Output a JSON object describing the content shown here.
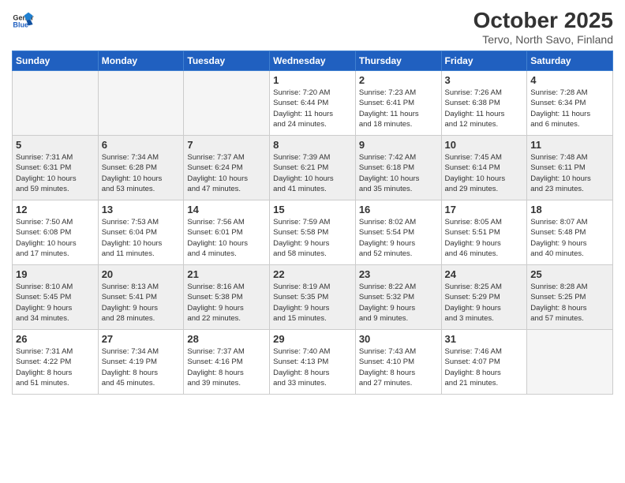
{
  "logo": {
    "general": "General",
    "blue": "Blue"
  },
  "header": {
    "month": "October 2025",
    "location": "Tervo, North Savo, Finland"
  },
  "weekdays": [
    "Sunday",
    "Monday",
    "Tuesday",
    "Wednesday",
    "Thursday",
    "Friday",
    "Saturday"
  ],
  "weeks": [
    [
      {
        "day": "",
        "info": ""
      },
      {
        "day": "",
        "info": ""
      },
      {
        "day": "",
        "info": ""
      },
      {
        "day": "1",
        "info": "Sunrise: 7:20 AM\nSunset: 6:44 PM\nDaylight: 11 hours\nand 24 minutes."
      },
      {
        "day": "2",
        "info": "Sunrise: 7:23 AM\nSunset: 6:41 PM\nDaylight: 11 hours\nand 18 minutes."
      },
      {
        "day": "3",
        "info": "Sunrise: 7:26 AM\nSunset: 6:38 PM\nDaylight: 11 hours\nand 12 minutes."
      },
      {
        "day": "4",
        "info": "Sunrise: 7:28 AM\nSunset: 6:34 PM\nDaylight: 11 hours\nand 6 minutes."
      }
    ],
    [
      {
        "day": "5",
        "info": "Sunrise: 7:31 AM\nSunset: 6:31 PM\nDaylight: 10 hours\nand 59 minutes."
      },
      {
        "day": "6",
        "info": "Sunrise: 7:34 AM\nSunset: 6:28 PM\nDaylight: 10 hours\nand 53 minutes."
      },
      {
        "day": "7",
        "info": "Sunrise: 7:37 AM\nSunset: 6:24 PM\nDaylight: 10 hours\nand 47 minutes."
      },
      {
        "day": "8",
        "info": "Sunrise: 7:39 AM\nSunset: 6:21 PM\nDaylight: 10 hours\nand 41 minutes."
      },
      {
        "day": "9",
        "info": "Sunrise: 7:42 AM\nSunset: 6:18 PM\nDaylight: 10 hours\nand 35 minutes."
      },
      {
        "day": "10",
        "info": "Sunrise: 7:45 AM\nSunset: 6:14 PM\nDaylight: 10 hours\nand 29 minutes."
      },
      {
        "day": "11",
        "info": "Sunrise: 7:48 AM\nSunset: 6:11 PM\nDaylight: 10 hours\nand 23 minutes."
      }
    ],
    [
      {
        "day": "12",
        "info": "Sunrise: 7:50 AM\nSunset: 6:08 PM\nDaylight: 10 hours\nand 17 minutes."
      },
      {
        "day": "13",
        "info": "Sunrise: 7:53 AM\nSunset: 6:04 PM\nDaylight: 10 hours\nand 11 minutes."
      },
      {
        "day": "14",
        "info": "Sunrise: 7:56 AM\nSunset: 6:01 PM\nDaylight: 10 hours\nand 4 minutes."
      },
      {
        "day": "15",
        "info": "Sunrise: 7:59 AM\nSunset: 5:58 PM\nDaylight: 9 hours\nand 58 minutes."
      },
      {
        "day": "16",
        "info": "Sunrise: 8:02 AM\nSunset: 5:54 PM\nDaylight: 9 hours\nand 52 minutes."
      },
      {
        "day": "17",
        "info": "Sunrise: 8:05 AM\nSunset: 5:51 PM\nDaylight: 9 hours\nand 46 minutes."
      },
      {
        "day": "18",
        "info": "Sunrise: 8:07 AM\nSunset: 5:48 PM\nDaylight: 9 hours\nand 40 minutes."
      }
    ],
    [
      {
        "day": "19",
        "info": "Sunrise: 8:10 AM\nSunset: 5:45 PM\nDaylight: 9 hours\nand 34 minutes."
      },
      {
        "day": "20",
        "info": "Sunrise: 8:13 AM\nSunset: 5:41 PM\nDaylight: 9 hours\nand 28 minutes."
      },
      {
        "day": "21",
        "info": "Sunrise: 8:16 AM\nSunset: 5:38 PM\nDaylight: 9 hours\nand 22 minutes."
      },
      {
        "day": "22",
        "info": "Sunrise: 8:19 AM\nSunset: 5:35 PM\nDaylight: 9 hours\nand 15 minutes."
      },
      {
        "day": "23",
        "info": "Sunrise: 8:22 AM\nSunset: 5:32 PM\nDaylight: 9 hours\nand 9 minutes."
      },
      {
        "day": "24",
        "info": "Sunrise: 8:25 AM\nSunset: 5:29 PM\nDaylight: 9 hours\nand 3 minutes."
      },
      {
        "day": "25",
        "info": "Sunrise: 8:28 AM\nSunset: 5:25 PM\nDaylight: 8 hours\nand 57 minutes."
      }
    ],
    [
      {
        "day": "26",
        "info": "Sunrise: 7:31 AM\nSunset: 4:22 PM\nDaylight: 8 hours\nand 51 minutes."
      },
      {
        "day": "27",
        "info": "Sunrise: 7:34 AM\nSunset: 4:19 PM\nDaylight: 8 hours\nand 45 minutes."
      },
      {
        "day": "28",
        "info": "Sunrise: 7:37 AM\nSunset: 4:16 PM\nDaylight: 8 hours\nand 39 minutes."
      },
      {
        "day": "29",
        "info": "Sunrise: 7:40 AM\nSunset: 4:13 PM\nDaylight: 8 hours\nand 33 minutes."
      },
      {
        "day": "30",
        "info": "Sunrise: 7:43 AM\nSunset: 4:10 PM\nDaylight: 8 hours\nand 27 minutes."
      },
      {
        "day": "31",
        "info": "Sunrise: 7:46 AM\nSunset: 4:07 PM\nDaylight: 8 hours\nand 21 minutes."
      },
      {
        "day": "",
        "info": ""
      }
    ]
  ]
}
